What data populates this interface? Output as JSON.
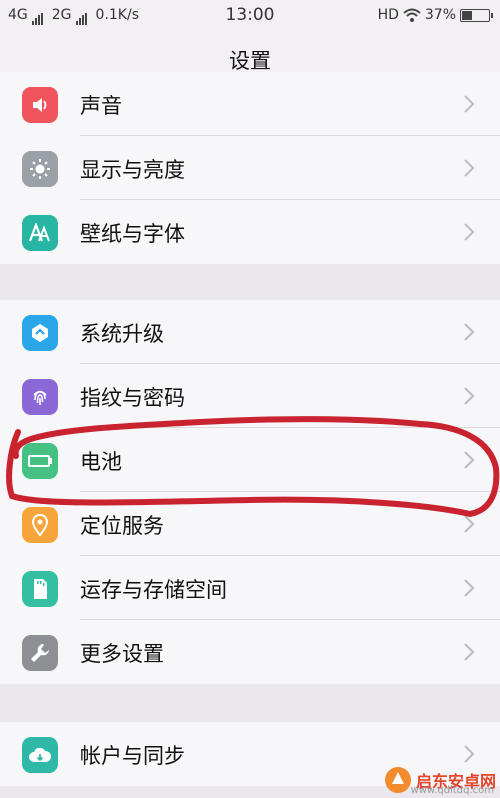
{
  "status": {
    "left": [
      "4G",
      "2G",
      "0.1K/s"
    ],
    "time": "13:00",
    "hd": "HD",
    "battery_percent": "37%",
    "battery_level": 0.37
  },
  "title": "设置",
  "groups": [
    {
      "items": [
        {
          "label": "声音",
          "icon": "speaker-icon",
          "color": "#f0545c"
        },
        {
          "label": "显示与亮度",
          "icon": "sun-icon",
          "color": "#9aa0a6"
        },
        {
          "label": "壁纸与字体",
          "icon": "font-icon",
          "color": "#28b5a4"
        }
      ]
    },
    {
      "items": [
        {
          "label": "系统升级",
          "icon": "upgrade-icon",
          "color": "#2aa6e8"
        },
        {
          "label": "指纹与密码",
          "icon": "fingerprint-icon",
          "color": "#8a68d6"
        },
        {
          "label": "电池",
          "icon": "battery-icon",
          "color": "#45c283"
        },
        {
          "label": "定位服务",
          "icon": "location-icon",
          "color": "#f6a53a"
        },
        {
          "label": "运存与存储空间",
          "icon": "storage-icon",
          "color": "#34c0a0"
        },
        {
          "label": "更多设置",
          "icon": "wrench-icon",
          "color": "#8d8f94"
        }
      ]
    },
    {
      "items": [
        {
          "label": "帐户与同步",
          "icon": "cloud-icon",
          "color": "#2fb8a8"
        }
      ]
    }
  ],
  "annotation_color": "#c8232f",
  "watermark": {
    "text": "启东安卓网",
    "sub": "www.qdltdq.com"
  }
}
